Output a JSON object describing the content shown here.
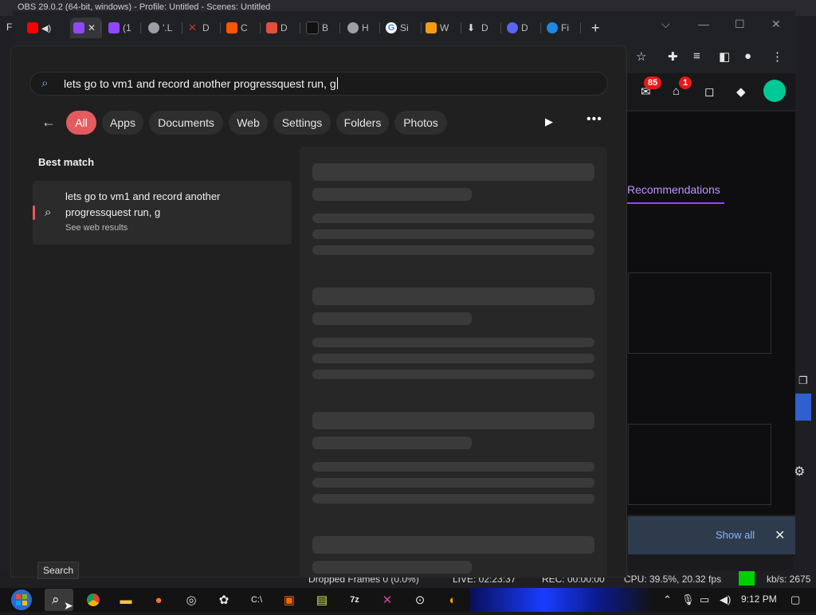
{
  "obs": {
    "title": "OBS 29.0.2 (64-bit, windows) - Profile: Untitled - Scenes: Untitled",
    "menu_first": "Fi",
    "status": {
      "dropped_frames": "Dropped Frames 0 (0.0%)",
      "live": "LIVE: 02:23:37",
      "rec": "REC: 00:00:00",
      "cpu": "CPU: 39.5%, 20.32 fps",
      "kbps": "kb/s: 2675"
    }
  },
  "browser": {
    "tabs": [
      {
        "label": "",
        "icon": "youtube-icon",
        "color": "#ff0000"
      },
      {
        "label": "",
        "icon": "twitch-icon",
        "color": "#9147ff",
        "active": true
      },
      {
        "label": "(1",
        "icon": "twitch-icon",
        "color": "#9147ff"
      },
      {
        "label": "'.L",
        "icon": "globe-icon",
        "color": "#9aa0a6"
      },
      {
        "label": "D",
        "icon": "cross-icon",
        "color": "#c0392b"
      },
      {
        "label": "C",
        "icon": "square-icon",
        "color": "#ff5500"
      },
      {
        "label": "D",
        "icon": "game-icon",
        "color": "#e74c3c"
      },
      {
        "label": "B",
        "icon": "dark-icon",
        "color": "#111111"
      },
      {
        "label": "H",
        "icon": "globe-icon",
        "color": "#9aa0a6"
      },
      {
        "label": "Si",
        "icon": "google-icon",
        "color": "#4285f4"
      },
      {
        "label": "W",
        "icon": "avatar-icon",
        "color": "#f39c12"
      },
      {
        "label": "D",
        "icon": "download-icon",
        "color": "#dddddd"
      },
      {
        "label": "D",
        "icon": "discord-icon",
        "color": "#5865f2"
      },
      {
        "label": "Fi",
        "icon": "file-icon",
        "color": "#1e88e5"
      }
    ],
    "new_tab": "+",
    "twitch": {
      "inbox_count": "85",
      "whispers_count": "1",
      "recommendations": "Recommendations"
    },
    "download_bar": {
      "show_all": "Show all",
      "close": "✕"
    }
  },
  "search": {
    "query": "lets go to vm1 and record another progressquest run, g",
    "filters": [
      "All",
      "Apps",
      "Documents",
      "Web",
      "Settings",
      "Folders",
      "Photos"
    ],
    "active_filter": "All",
    "best_match_label": "Best match",
    "result": {
      "line1": "lets go to vm1 and record another",
      "line2": "progressquest run, g",
      "subtitle": "See web results"
    },
    "tooltip": "Search",
    "accent_color": "#e45b5f"
  },
  "taskbar": {
    "clock": "9:12 PM"
  }
}
